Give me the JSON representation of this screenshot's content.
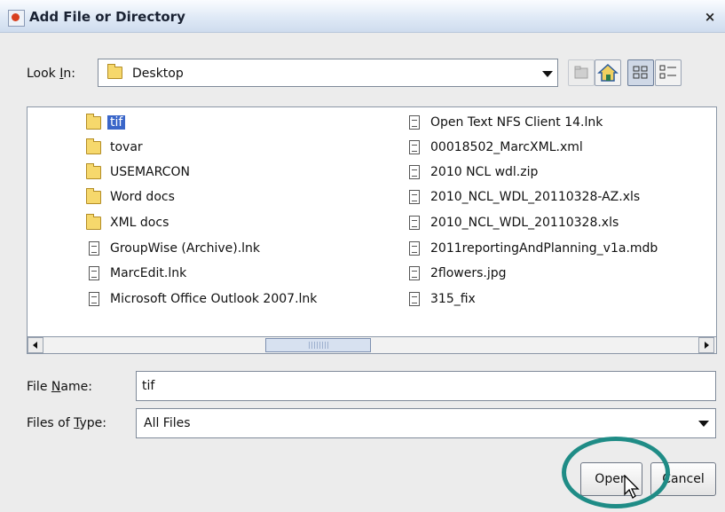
{
  "dialog": {
    "title": "Add File or Directory",
    "close_label": "×"
  },
  "lookin": {
    "label_pre": "Look ",
    "label_mn": "I",
    "label_post": "n:",
    "value": "Desktop"
  },
  "files_left": [
    {
      "name": "tif",
      "type": "folder",
      "selected": true
    },
    {
      "name": "tovar",
      "type": "folder"
    },
    {
      "name": "USEMARCON",
      "type": "folder"
    },
    {
      "name": "Word docs",
      "type": "folder"
    },
    {
      "name": "XML docs",
      "type": "folder"
    },
    {
      "name": "GroupWise (Archive).lnk",
      "type": "file"
    },
    {
      "name": "MarcEdit.lnk",
      "type": "file"
    },
    {
      "name": "Microsoft Office Outlook 2007.lnk",
      "type": "file"
    }
  ],
  "files_right": [
    {
      "name": "Open Text NFS Client 14.lnk",
      "type": "file"
    },
    {
      "name": "00018502_MarcXML.xml",
      "type": "file"
    },
    {
      "name": "2010 NCL wdl.zip",
      "type": "file"
    },
    {
      "name": "2010_NCL_WDL_20110328-AZ.xls",
      "type": "file"
    },
    {
      "name": "2010_NCL_WDL_20110328.xls",
      "type": "file"
    },
    {
      "name": "2011reportingAndPlanning_v1a.mdb",
      "type": "file"
    },
    {
      "name": "2flowers.jpg",
      "type": "file"
    },
    {
      "name": "315_fix",
      "type": "file"
    }
  ],
  "filename": {
    "label_pre": "File ",
    "label_mn": "N",
    "label_post": "ame:",
    "value": "tif"
  },
  "filetype": {
    "label_pre": "Files of ",
    "label_mn": "T",
    "label_post": "ype:",
    "value": "All Files"
  },
  "buttons": {
    "open": "Open",
    "cancel": "Cancel"
  },
  "colors": {
    "highlight": "#3a66c9",
    "annotation_circle": "#1f8c86"
  },
  "icons": [
    "java-icon",
    "folder-icon",
    "up-folder-icon",
    "home-icon",
    "list-view-icon",
    "details-view-icon",
    "file-icon",
    "mouse-cursor-icon"
  ]
}
